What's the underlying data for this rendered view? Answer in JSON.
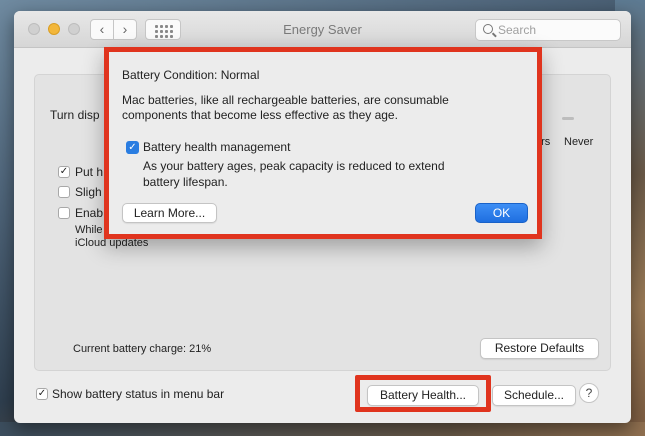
{
  "window": {
    "title": "Energy Saver",
    "search_placeholder": "Search",
    "nav_back": "‹",
    "nav_fwd": "›"
  },
  "panel": {
    "turn_display_off_label": "Turn disp",
    "slider_end_labels": [
      "hrs",
      "Never"
    ],
    "options": [
      {
        "label": "Put h",
        "checked": true
      },
      {
        "label": "Sligh",
        "checked": false
      },
      {
        "label": "Enab",
        "checked": false
      }
    ],
    "enable_note_line1": "While",
    "enable_note_line2": "iCloud updates",
    "battery_charge": "Current battery charge: 21%",
    "restore_defaults": "Restore Defaults"
  },
  "footer": {
    "show_battery_status": "Show battery status in menu bar",
    "show_battery_status_checked": true,
    "battery_health_button": "Battery Health...",
    "schedule_button": "Schedule...",
    "help_button": "?"
  },
  "dialog": {
    "condition": "Battery Condition:  Normal",
    "desc_line1": "Mac batteries, like all rechargeable batteries, are consumable",
    "desc_line2": "components that become less effective as they age.",
    "management_label": "Battery health management",
    "management_checked": true,
    "management_desc_line1": "As your battery ages, peak capacity is reduced to extend",
    "management_desc_line2": "battery lifespan.",
    "learn_more": "Learn More...",
    "ok": "OK"
  },
  "colors": {
    "highlight": "#e0341e",
    "accent_blue": "#2a7de1"
  }
}
